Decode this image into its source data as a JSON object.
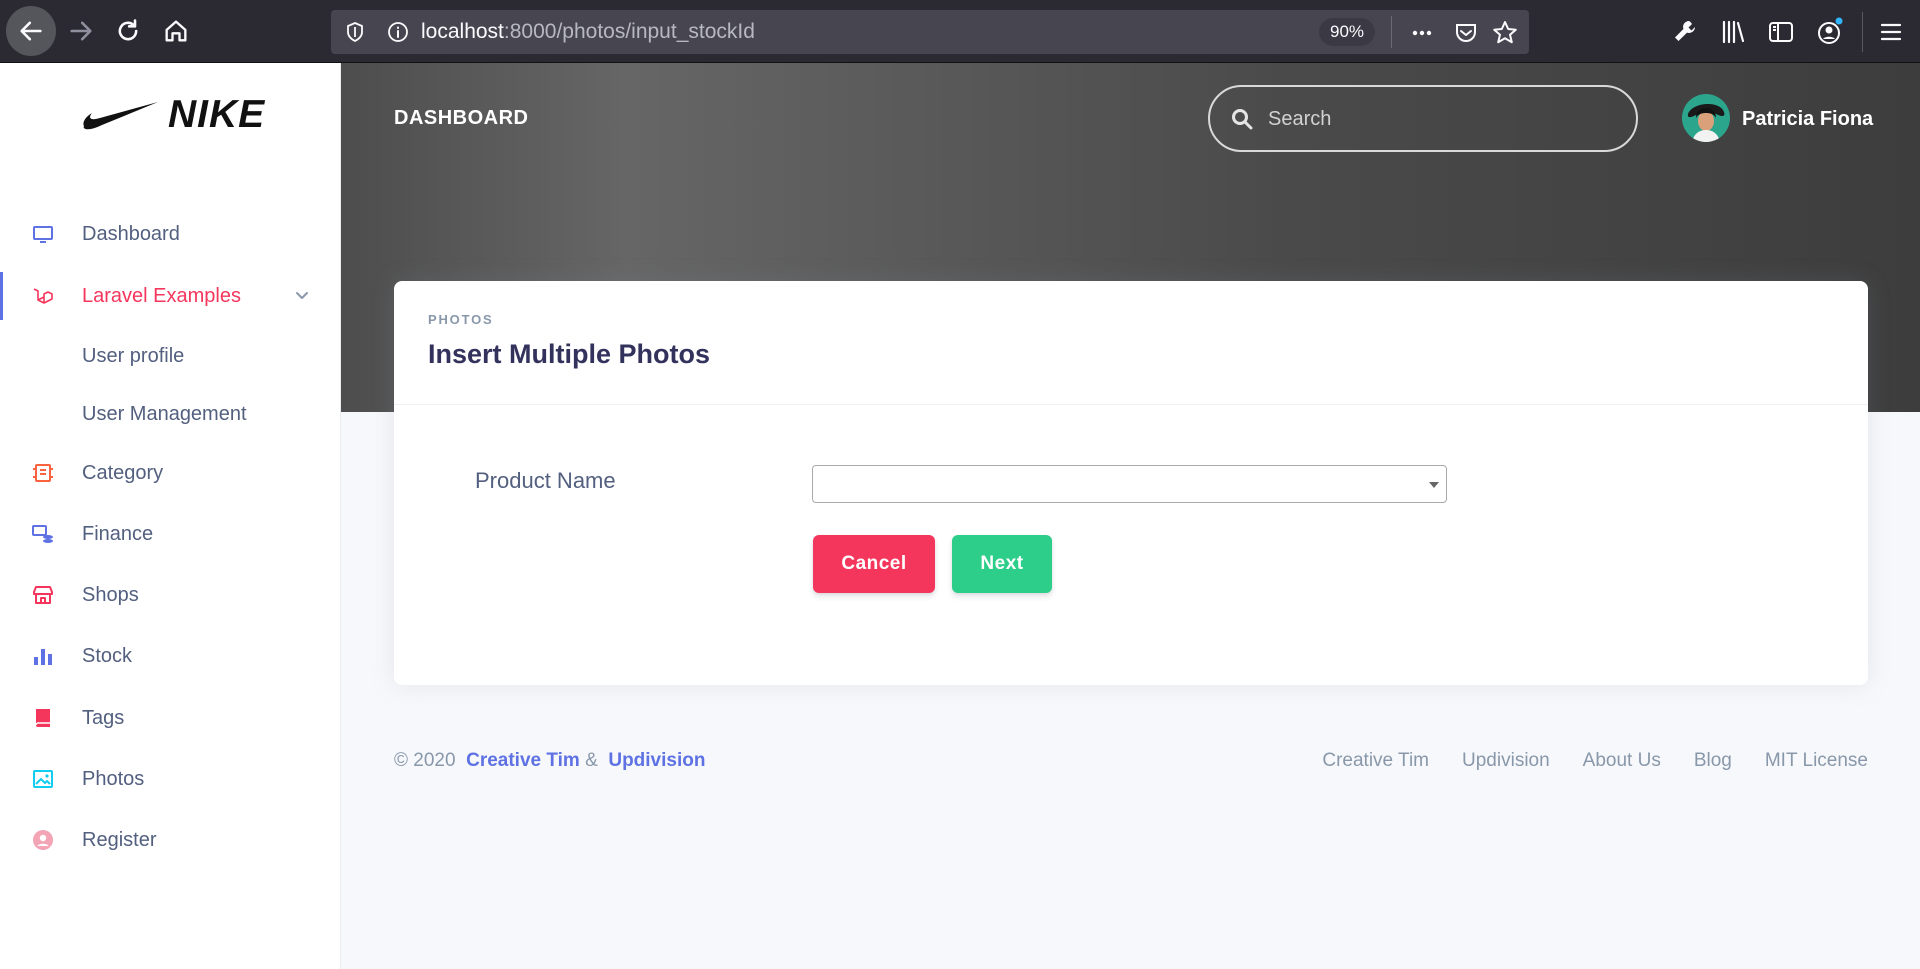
{
  "browser": {
    "url_host": "localhost",
    "url_rest": ":8000/photos/input_stockId",
    "zoom": "90%"
  },
  "brand": {
    "name": "NIKE"
  },
  "sidebar": {
    "items": [
      {
        "label": "Dashboard",
        "icon": "monitor-icon",
        "color": "#5e72e4"
      },
      {
        "label": "Laravel Examples",
        "icon": "laravel-icon",
        "color": "#f5365c",
        "active": true
      },
      {
        "label": "User profile"
      },
      {
        "label": "User Management"
      },
      {
        "label": "Category",
        "icon": "category-icon",
        "color": "#fb6340"
      },
      {
        "label": "Finance",
        "icon": "finance-icon",
        "color": "#5e72e4"
      },
      {
        "label": "Shops",
        "icon": "shop-icon",
        "color": "#f5365c"
      },
      {
        "label": "Stock",
        "icon": "bar-chart-icon",
        "color": "#5e72e4"
      },
      {
        "label": "Tags",
        "icon": "book-icon",
        "color": "#f5365c"
      },
      {
        "label": "Photos",
        "icon": "image-icon",
        "color": "#11cdef"
      },
      {
        "label": "Register",
        "icon": "user-circle-icon",
        "color": "#f3a4b5"
      }
    ]
  },
  "header": {
    "title": "DASHBOARD",
    "search_placeholder": "Search",
    "user_name": "Patricia Fiona"
  },
  "card": {
    "kicker": "PHOTOS",
    "title": "Insert Multiple Photos",
    "field_label": "Product Name",
    "select_value": "",
    "cancel_label": "Cancel",
    "next_label": "Next"
  },
  "footer": {
    "copyright_prefix": "© 2020",
    "author1": "Creative Tim",
    "amp": "&",
    "author2": "Updivision",
    "links": [
      "Creative Tim",
      "Updivision",
      "About Us",
      "Blog",
      "MIT License"
    ]
  },
  "colors": {
    "primary": "#5e72e4",
    "danger": "#f5365c",
    "success": "#2dce89"
  }
}
